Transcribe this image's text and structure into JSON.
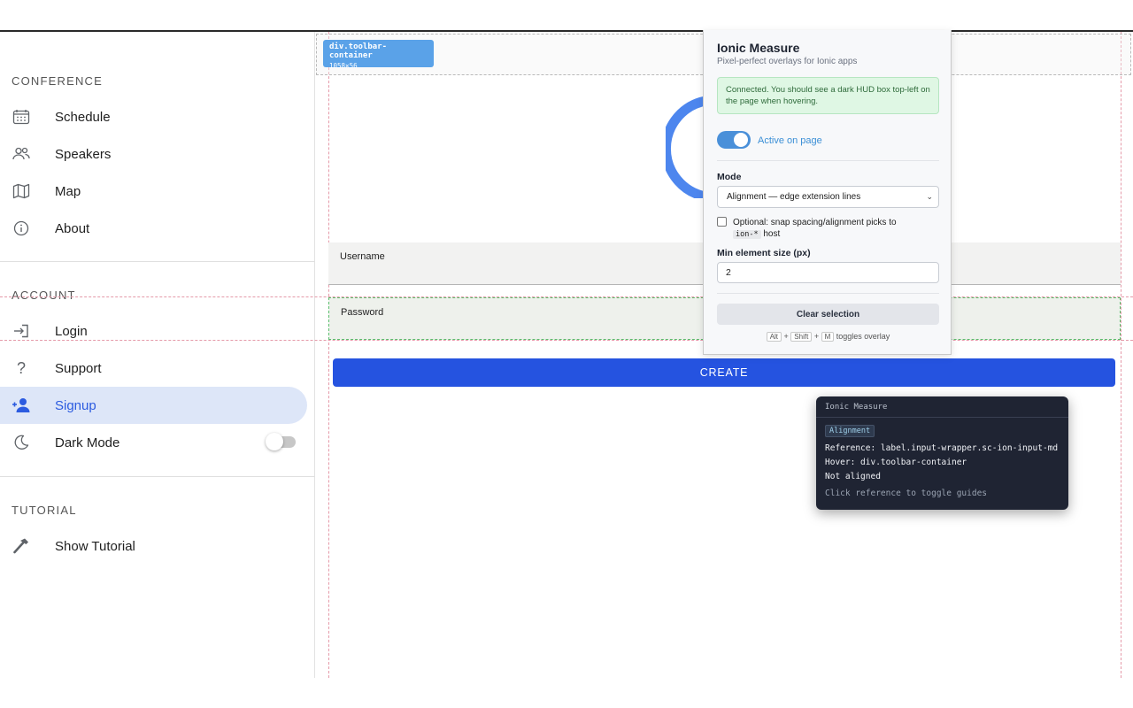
{
  "sidebar": {
    "sections": {
      "conference": "CONFERENCE",
      "account": "ACCOUNT",
      "tutorial": "TUTORIAL"
    },
    "items": {
      "schedule": "Schedule",
      "speakers": "Speakers",
      "map": "Map",
      "about": "About",
      "login": "Login",
      "support": "Support",
      "signup": "Signup",
      "dark_mode": "Dark Mode",
      "show_tutorial": "Show Tutorial"
    },
    "dark_mode_on": false,
    "active_item": "signup"
  },
  "inspector": {
    "tag_selector": "div.toolbar-container",
    "tag_size": "1058×56"
  },
  "form": {
    "username_label": "Username",
    "password_label": "Password",
    "create_label": "CREATE"
  },
  "popup": {
    "title": "Ionic Measure",
    "subtitle": "Pixel-perfect overlays for Ionic apps",
    "status": "Connected. You should see a dark HUD box top-left on the page when hovering.",
    "active_label": "Active on page",
    "active_on": true,
    "mode_label": "Mode",
    "mode_value": "Alignment — edge extension lines",
    "snap_text_before": "Optional: snap spacing/alignment picks to",
    "snap_code": "ion-*",
    "snap_text_after": "host",
    "snap_checked": false,
    "min_size_label": "Min element size (px)",
    "min_size_value": "2",
    "clear_label": "Clear selection",
    "hint_keys": [
      "Alt",
      "Shift",
      "M"
    ],
    "hint_text": "toggles overlay"
  },
  "hud": {
    "title": "Ionic Measure",
    "badge": "Alignment",
    "reference": "Reference: label.input-wrapper.sc-ion-input-md",
    "hover": "Hover: div.toolbar-container",
    "result": "Not aligned",
    "footer": "Click reference to toggle guides"
  },
  "colors": {
    "accent": "#2553e0",
    "active_bg": "#dde6f8",
    "hud_bg": "#1f2433",
    "guide": "#e59aa9",
    "status_bg": "#dff7e4"
  }
}
